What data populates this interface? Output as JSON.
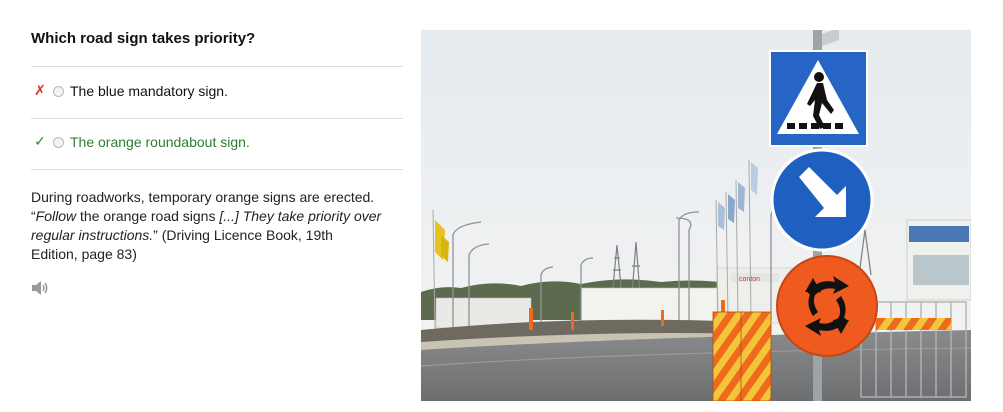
{
  "question": "Which road sign takes priority?",
  "options": [
    {
      "label": "The blue mandatory sign.",
      "result_mark": "✗",
      "result": "wrong"
    },
    {
      "label": "The orange roundabout sign.",
      "result_mark": "✓",
      "result": "correct"
    }
  ],
  "explanation": {
    "line1": "During roadworks, temporary orange signs are erected.",
    "quote_open": "“",
    "quote_em1": "Follow",
    "quote_mid": " the orange road signs ",
    "quote_em2": "[...] They take priority over regular instructions.",
    "quote_close": "”",
    "source": " (Driving Licence Book, 19th Edition, page 83)"
  },
  "speaker_icon": "speaker-icon",
  "photo": {
    "description_icon": "road-signs-photo",
    "store_sign_text": "conton",
    "colors": {
      "sign_blue": "#1f5fbf",
      "sign_orange": "#ef5a1f",
      "correct_green": "#2e7d32",
      "wrong_red": "#d93025"
    }
  }
}
